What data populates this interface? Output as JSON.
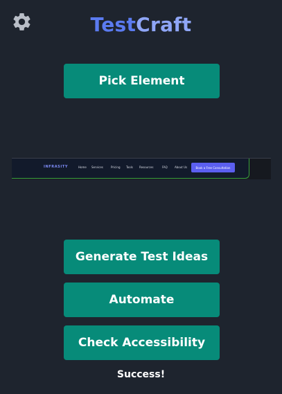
{
  "header": {
    "title_part1": "Test",
    "title_part2": "Craft",
    "settings_icon": "gear-icon"
  },
  "actions": {
    "pick_element": "Pick Element",
    "generate_test_ideas": "Generate Test Ideas",
    "automate": "Automate",
    "check_accessibility": "Check Accessibility"
  },
  "preview": {
    "logo": "INFRASITY",
    "nav_items": [
      "Home",
      "Services",
      "Pricing",
      "Tools",
      "Resources",
      "FAQ",
      "About Us"
    ],
    "cta": "Book a Free Consultation"
  },
  "status": {
    "message": "Success!"
  },
  "colors": {
    "background": "#1e242e",
    "button": "#078b79",
    "title_primary": "#5b7bf0",
    "title_secondary": "#8fa6f7",
    "cta": "#5b5ff0"
  }
}
